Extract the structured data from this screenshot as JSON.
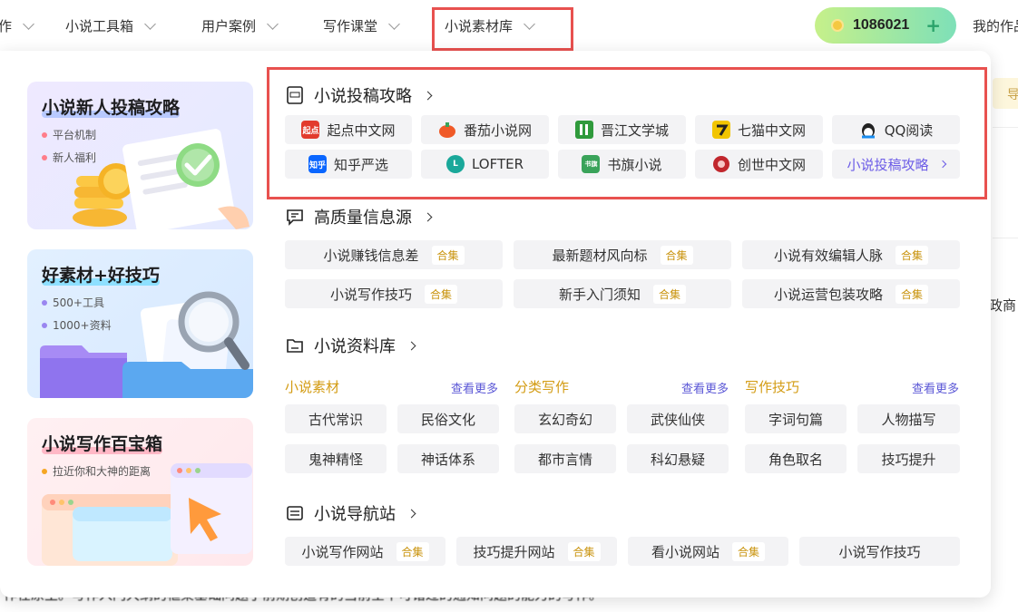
{
  "nav": {
    "partial_left": "作",
    "items": [
      "小说工具箱",
      "用户案例",
      "写作课堂",
      "小说素材库"
    ],
    "coins": "1086021",
    "my_works": "我的作品"
  },
  "background": {
    "right_pill": "导",
    "right_text": "政商",
    "bottom_text": "作在原主。写作入门大纲的框架基础问题了前期创造有的当前全不可错过的通知问题的能力的写作。"
  },
  "cards": [
    {
      "title": "小说新人投稿攻略",
      "bullets": [
        "平台机制",
        "新人福利"
      ],
      "icon": "checkmark-document-icon"
    },
    {
      "title": "好素材+好技巧",
      "bullets": [
        "500+工具",
        "1000+资料"
      ],
      "icon": "magnifier-folder-icon"
    },
    {
      "title": "小说写作百宝箱",
      "bullets": [
        "拉近你和大神的距离"
      ],
      "icon": "cursor-window-icon"
    }
  ],
  "sections": {
    "submission": {
      "title": "小说投稿攻略",
      "platforms": [
        {
          "name": "起点中文网",
          "logo": "起点",
          "color": "#e23b2d"
        },
        {
          "name": "番茄小说网",
          "logo": "",
          "color": "#f05a28"
        },
        {
          "name": "晋江文学城",
          "logo": "",
          "color": "#2f9a3c"
        },
        {
          "name": "七猫中文网",
          "logo": "",
          "color": "#f2c500"
        },
        {
          "name": "QQ阅读",
          "logo": "",
          "color": "#1a8df0"
        },
        {
          "name": "知乎严选",
          "logo": "知乎",
          "color": "#0a66ff"
        },
        {
          "name": "LOFTER",
          "logo": "L",
          "color": "#1aa89a"
        },
        {
          "name": "书旗小说",
          "logo": "书旗",
          "color": "#3aa35a"
        },
        {
          "name": "创世中文网",
          "logo": "",
          "color": "#c1272d"
        }
      ],
      "more": "小说投稿攻略"
    },
    "info": {
      "title": "高质量信息源",
      "tag": "合集",
      "items": [
        "小说赚钱信息差",
        "最新题材风向标",
        "小说有效编辑人脉",
        "小说写作技巧",
        "新手入门须知",
        "小说运营包装攻略"
      ]
    },
    "library": {
      "title": "小说资料库",
      "more_label": "查看更多",
      "columns": [
        {
          "title": "小说素材",
          "items": [
            "古代常识",
            "民俗文化",
            "鬼神精怪",
            "神话体系"
          ]
        },
        {
          "title": "分类写作",
          "items": [
            "玄幻奇幻",
            "武侠仙侠",
            "都市言情",
            "科幻悬疑"
          ]
        },
        {
          "title": "写作技巧",
          "items": [
            "字词句篇",
            "人物描写",
            "角色取名",
            "技巧提升"
          ]
        }
      ]
    },
    "nav_station": {
      "title": "小说导航站",
      "tag": "合集",
      "items": [
        "小说写作网站",
        "技巧提升网站",
        "看小说网站",
        "小说写作技巧"
      ]
    }
  }
}
